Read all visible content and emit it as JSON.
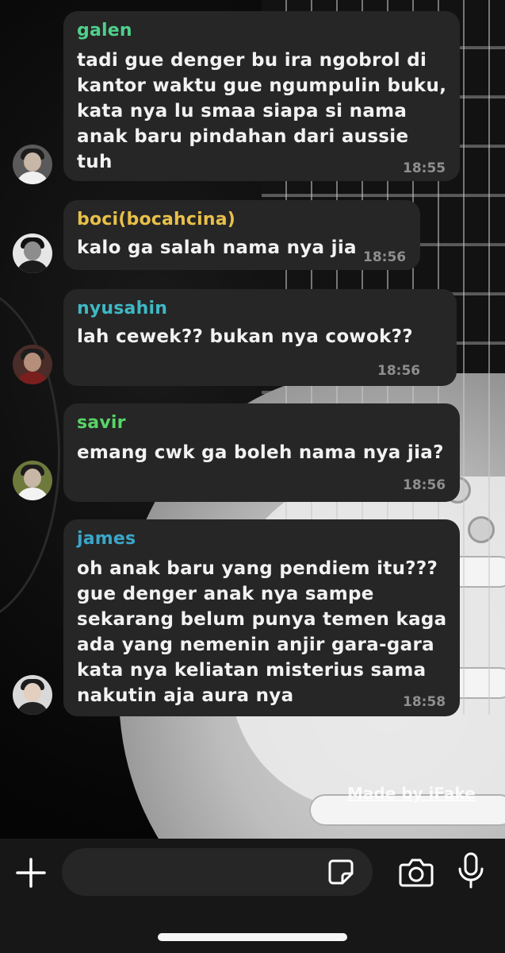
{
  "chat": {
    "messages": [
      {
        "sender": "galen",
        "sender_color": "#4fd08a",
        "lines": [
          "tadi gue denger bu ira ngobrol di",
          "kantor waktu gue ngumpulin buku,",
          "kata nya lu smaa siapa si nama",
          "anak baru pindahan dari aussie",
          "tuh"
        ],
        "time": "18:55"
      },
      {
        "sender": "boci(bocahcina)",
        "sender_color": "#e8c04a",
        "lines": [
          "kalo ga salah nama nya jia"
        ],
        "time": "18:56"
      },
      {
        "sender": "nyusahin",
        "sender_color": "#3fb8c4",
        "lines": [
          "lah cewek?? bukan nya cowok??"
        ],
        "time": "18:56"
      },
      {
        "sender": "savir",
        "sender_color": "#58d468",
        "lines": [
          "emang cwk ga boleh nama nya jia?"
        ],
        "time": "18:56"
      },
      {
        "sender": "james",
        "sender_color": "#3aa6c9",
        "lines": [
          "oh anak baru yang pendiem itu???",
          "gue denger anak nya sampe",
          "sekarang belum punya temen kaga",
          "ada yang nemenin anjir gara-gara",
          "kata nya keliatan misterius sama",
          "nakutin aja aura nya"
        ],
        "time": "18:58"
      }
    ]
  },
  "watermark": "Made by iFake",
  "composer": {
    "placeholder": "",
    "icons": [
      "plus-icon",
      "sticker-icon",
      "camera-icon",
      "microphone-icon"
    ]
  },
  "colors": {
    "bubble": "#262626",
    "timestamp": "#8e8e8e",
    "message_text": "#f2f2f2",
    "composer_bar": "#171717"
  }
}
